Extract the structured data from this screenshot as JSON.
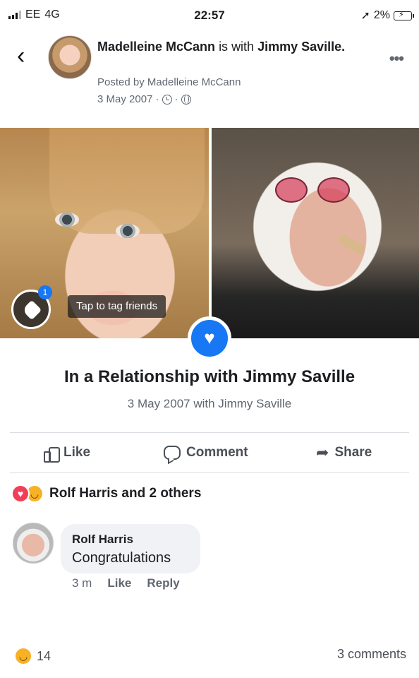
{
  "status_bar": {
    "carrier": "EE",
    "network": "4G",
    "time": "22:57",
    "battery_percent": "2%"
  },
  "post": {
    "author": "Madelleine McCann",
    "with_text": "is with",
    "tagged": "Jimmy Saville.",
    "posted_by": "Posted by Madelleine McCann",
    "date": "3 May 2007 ·",
    "date_sep": "·"
  },
  "photo": {
    "tag_count": "1",
    "tag_label": "Tap to tag friends"
  },
  "life_event": {
    "title": "In a Relationship with Jimmy Saville",
    "subtitle": "3 May 2007 with Jimmy Saville"
  },
  "actions": {
    "like": "Like",
    "comment": "Comment",
    "share": "Share"
  },
  "reactions": {
    "summary": "Rolf Harris and 2 others"
  },
  "comment": {
    "author": "Rolf Harris",
    "text": "Congratulations",
    "age": "3 m",
    "like": "Like",
    "reply": "Reply"
  },
  "footer": {
    "reaction_count": "14",
    "comments_count": "3 comments"
  },
  "colors": {
    "accent": "#1877f2",
    "heart": "#f33e58",
    "haha": "#f7b125",
    "secondary_text": "#606770"
  }
}
